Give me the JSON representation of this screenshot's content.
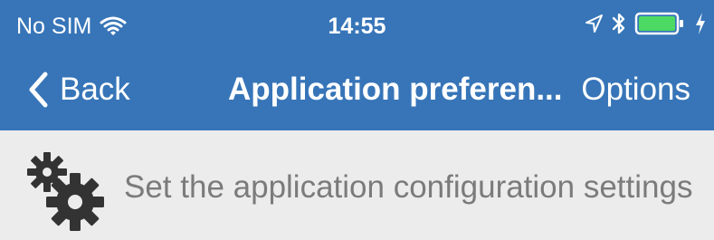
{
  "status_bar": {
    "carrier": "No SIM",
    "time": "14:55",
    "icons": [
      "wifi-icon",
      "location-arrow-icon",
      "bluetooth-icon",
      "battery-icon",
      "charging-icon"
    ],
    "battery_level": 1.0,
    "battery_color": "#4cd964"
  },
  "navigation": {
    "back_label": "Back",
    "title": "Application preferen...",
    "options_label": "Options"
  },
  "content": {
    "icon": "gears-icon",
    "description": "Set the application configuration settings"
  },
  "colors": {
    "accent": "#3775b8",
    "background": "#ececec",
    "text_muted": "#7b7b7b",
    "icon_dark": "#333333"
  }
}
